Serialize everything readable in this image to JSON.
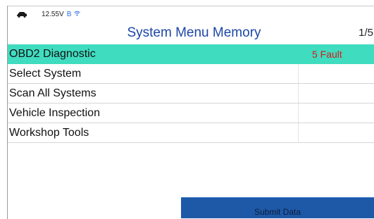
{
  "status": {
    "voltage": "12.55V",
    "indicator": "B",
    "wifi_icon": "wifi-icon",
    "vehicle_icon": "car-icon"
  },
  "header": {
    "title": "System Menu Memory",
    "page": "1/5"
  },
  "menu": {
    "items": [
      {
        "label": "OBD2 Diagnostic",
        "badge": "5 Fault",
        "selected": true
      },
      {
        "label": "Select System",
        "badge": ""
      },
      {
        "label": "Scan All Systems",
        "badge": ""
      },
      {
        "label": "Vehicle Inspection",
        "badge": ""
      },
      {
        "label": "Workshop Tools",
        "badge": ""
      }
    ]
  },
  "footer": {
    "submit_label": "Submit Data"
  },
  "colors": {
    "selected_row": "#40dcc0",
    "title": "#1d46a6",
    "fault": "#d11d1d",
    "button": "#1e59a8"
  }
}
